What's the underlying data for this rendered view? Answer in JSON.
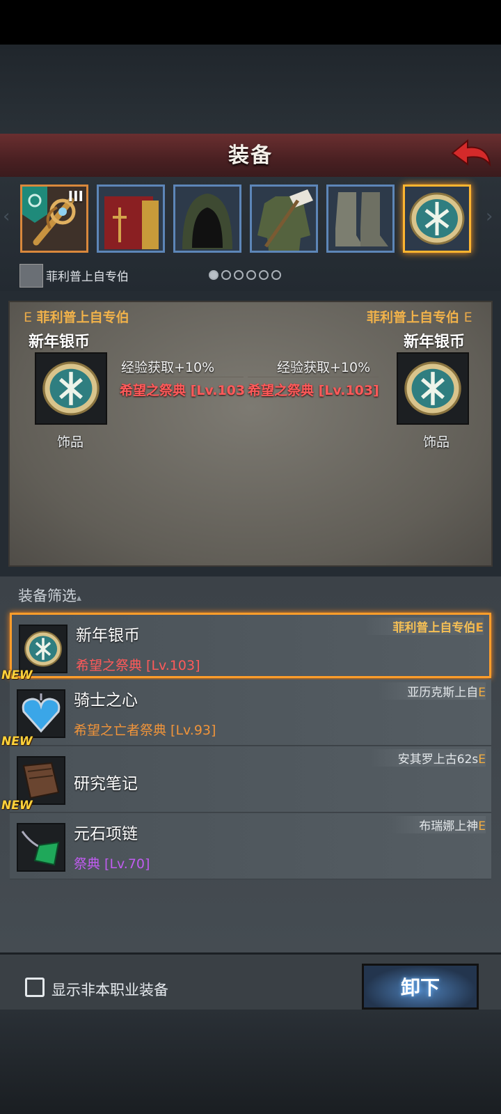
{
  "header": {
    "title": "装备",
    "back_icon": "back-arrow-icon"
  },
  "character": {
    "name": "菲利普上自专伯",
    "avatar_icon": "character-portrait"
  },
  "slots": [
    {
      "name": "weapon",
      "icon": "weapon-icon",
      "tier": "III",
      "badge_icon": "rank-shield-icon"
    },
    {
      "name": "book",
      "icon": "book-icon"
    },
    {
      "name": "hood",
      "icon": "hood-icon"
    },
    {
      "name": "armor",
      "icon": "armor-icon"
    },
    {
      "name": "boots",
      "icon": "boots-icon"
    },
    {
      "name": "accessory",
      "icon": "silver-coin-icon",
      "selected": true
    }
  ],
  "pagination": {
    "count": 6,
    "active": 0
  },
  "compare": {
    "left": {
      "owner": "菲利普上自专伯",
      "grade": "E",
      "name": "新年银币",
      "category": "饰品",
      "stat": "经验获取+10%",
      "set": "希望之祭典 [Lv.103"
    },
    "right": {
      "owner": "菲利普上自专伯",
      "grade": "E",
      "name": "新年银币",
      "category": "饰品",
      "stat": "经验获取+10%",
      "set": "希望之祭典 [Lv.103]"
    }
  },
  "filter": {
    "label": "装备筛选",
    "arrow": "▴"
  },
  "items": [
    {
      "name": "新年银币",
      "set": "希望之祭典 [Lv.103]",
      "set_color": "#ff5a5a",
      "owner": "菲利普上自专伯",
      "grade": "E",
      "is_new": false,
      "selected": true,
      "icon": "silver-coin-icon"
    },
    {
      "name": "骑士之心",
      "set": "希望之亡者祭典 [Lv.93]",
      "set_color": "#f0943a",
      "owner": "亚历克斯上自",
      "grade": "E",
      "is_new": true,
      "selected": false,
      "icon": "heart-pendant-icon"
    },
    {
      "name": "研究笔记",
      "set": "",
      "set_color": "",
      "owner": "安其罗上古62s",
      "grade": "E",
      "is_new": true,
      "selected": false,
      "icon": "notebook-icon"
    },
    {
      "name": "元石项链",
      "set": "祭典 [Lv.70]",
      "set_color": "#c05cf0",
      "owner": "布瑞娜上神",
      "grade": "E",
      "is_new": true,
      "selected": false,
      "icon": "crystal-necklace-icon"
    }
  ],
  "new_badge": "NEW",
  "bottom": {
    "checkbox_label": "显示非本职业装备",
    "checkbox_checked": false,
    "unequip_label": "卸下"
  },
  "colors": {
    "accent_orange": "#ff9d2a",
    "header_red": "#6a2f30",
    "button_blue": "#4d7fb8"
  }
}
